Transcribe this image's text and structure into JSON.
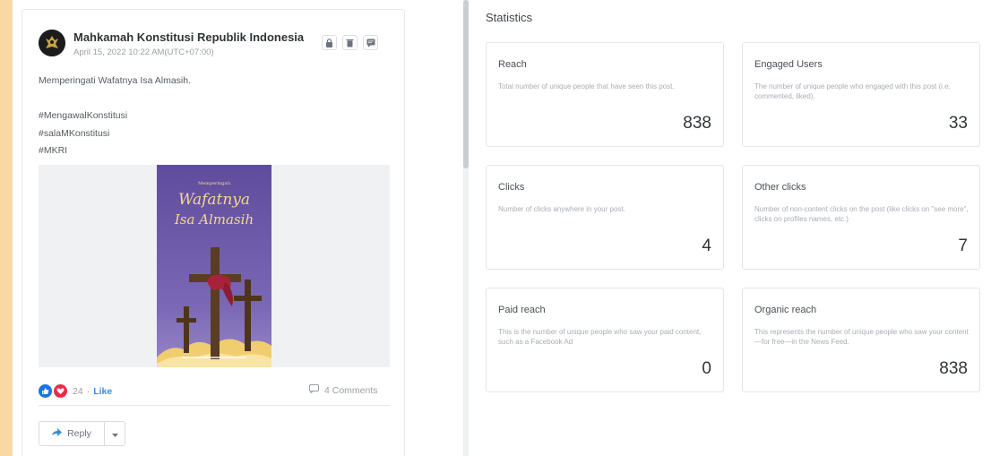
{
  "post": {
    "page_name": "Mahkamah Konstitusi Republik Indonesia",
    "date": "April 15, 2022 10:22 AM(UTC+07:00)",
    "header_icons": [
      "lock-icon",
      "trash-icon",
      "note-icon"
    ],
    "lines": [
      "Memperingati Wafatnya Isa Almasih.",
      "",
      "#MengawalKonstitusi",
      "#salaMKonstitusi",
      "#MKRI"
    ],
    "poster": {
      "subtitle": "Memperingati",
      "title_line1": "Wafatnya",
      "title_line2": "Isa Almasih",
      "colors": {
        "sky": "#6e5aa8",
        "cross": "#5a3d24",
        "cloud": "#f6dc8e",
        "sash": "#a8233a"
      }
    },
    "reactions": {
      "count": "24",
      "separator": "·",
      "like_label": "Like"
    },
    "comments_label": "4 Comments",
    "reply_label": "Reply"
  },
  "statistics": {
    "title": "Statistics",
    "cards": [
      {
        "title": "Reach",
        "desc": "Total number of unique people that have seen this post.",
        "value": "838"
      },
      {
        "title": "Engaged Users",
        "desc": "The number of unique people who engaged with this post (i.e. commented, liked).",
        "value": "33"
      },
      {
        "title": "Clicks",
        "desc": "Number of clicks anywhere in your post.",
        "value": "4"
      },
      {
        "title": "Other clicks",
        "desc": "Number of non-content clicks on the post (like clicks on \"see more\", clicks on profiles names, etc.)",
        "value": "7"
      },
      {
        "title": "Paid reach",
        "desc": "This is the number of unique people who saw your paid content, such as a Facebook Ad",
        "value": "0"
      },
      {
        "title": "Organic reach",
        "desc": "This represents the number of unique people who saw your content—for free—in the News Feed.",
        "value": "838"
      }
    ]
  },
  "colors": {
    "accent": "#3c8ed6",
    "like": "#1b74e4",
    "love": "#f0284a",
    "background": "#f8d9a3"
  }
}
